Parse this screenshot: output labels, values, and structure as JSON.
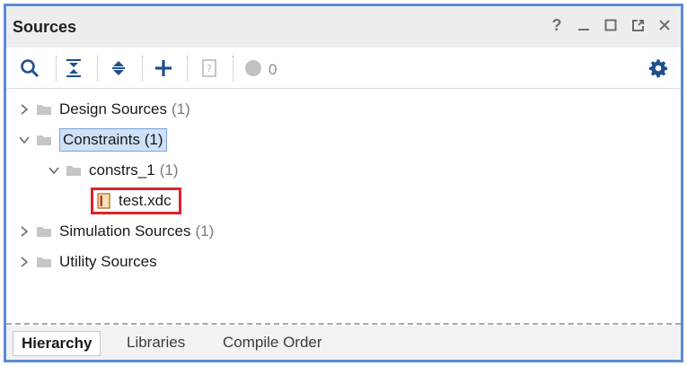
{
  "panel": {
    "title": "Sources"
  },
  "window_controls": [
    "help-icon",
    "minimize-icon",
    "maximize-icon",
    "float-icon",
    "close-icon"
  ],
  "toolbar": {
    "status_count": "0",
    "icons": [
      "search-icon",
      "collapse-all-icon",
      "expand-all-icon",
      "add-icon",
      "file-properties-icon",
      "status-dot-icon",
      "gear-icon"
    ]
  },
  "tree": [
    {
      "label": "Design Sources",
      "count": "(1)",
      "expanded": false
    },
    {
      "label": "Constraints",
      "count": "(1)",
      "expanded": true,
      "selected": true
    },
    {
      "label": "constrs_1",
      "count": "(1)",
      "expanded": true
    },
    {
      "label": "test.xdc",
      "count": "",
      "highlighted": true
    },
    {
      "label": "Simulation Sources",
      "count": "(1)",
      "expanded": false
    },
    {
      "label": "Utility Sources",
      "count": "",
      "expanded": false
    }
  ],
  "tabs": [
    {
      "label": "Hierarchy",
      "active": true
    },
    {
      "label": "Libraries",
      "active": false
    },
    {
      "label": "Compile Order",
      "active": false
    }
  ],
  "colors": {
    "accent_border": "#5a8bd6",
    "selection": "#cfe1f7",
    "highlight": "#e0222a",
    "icon_blue": "#1e4f8c"
  }
}
